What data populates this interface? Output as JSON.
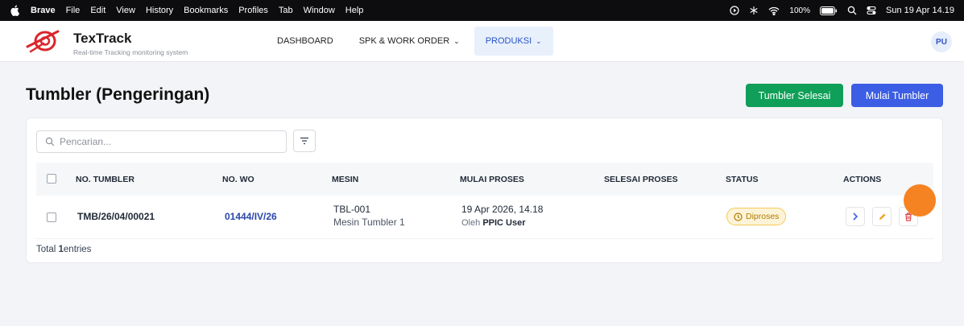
{
  "menubar": {
    "app": "Brave",
    "menus": [
      "File",
      "Edit",
      "View",
      "History",
      "Bookmarks",
      "Profiles",
      "Tab",
      "Window",
      "Help"
    ],
    "battery": "100%",
    "datetime": "Sun 19 Apr 14.19"
  },
  "header": {
    "brand_title": "TexTrack",
    "brand_subtitle": "Real-time Tracking monitoring system",
    "nav": [
      {
        "label": "DASHBOARD"
      },
      {
        "label": "SPK & WORK ORDER"
      },
      {
        "label": "PRODUKSI"
      }
    ],
    "avatar_initials": "PU"
  },
  "page": {
    "title": "Tumbler (Pengeringan)",
    "btn_done": "Tumbler Selesai",
    "btn_start": "Mulai Tumbler"
  },
  "search": {
    "placeholder": "Pencarian..."
  },
  "table": {
    "headers": {
      "no_tumbler": "NO. TUMBLER",
      "no_wo": "NO. WO",
      "mesin": "MESIN",
      "mulai": "MULAI PROSES",
      "selesai": "SELESAI PROSES",
      "status": "STATUS",
      "actions": "ACTIONS"
    },
    "rows": [
      {
        "no_tumbler": "TMB/26/04/00021",
        "no_wo": "01444/IV/26",
        "mesin_code": "TBL-001",
        "mesin_name": "Mesin Tumbler 1",
        "mulai_time": "19 Apr 2026, 14.18",
        "mulai_by_prefix": "Oleh",
        "mulai_by": "PPIC User",
        "selesai": "",
        "status": "Diproses"
      }
    ],
    "total_count": "1",
    "total_suffix": "entries",
    "total_prefix": "Total"
  },
  "colors": {
    "primary": "#3c5ee5",
    "success": "#0f9f58",
    "warning": "#f4c95a",
    "danger": "#e5484d",
    "cursor_dot": "#f58322"
  }
}
